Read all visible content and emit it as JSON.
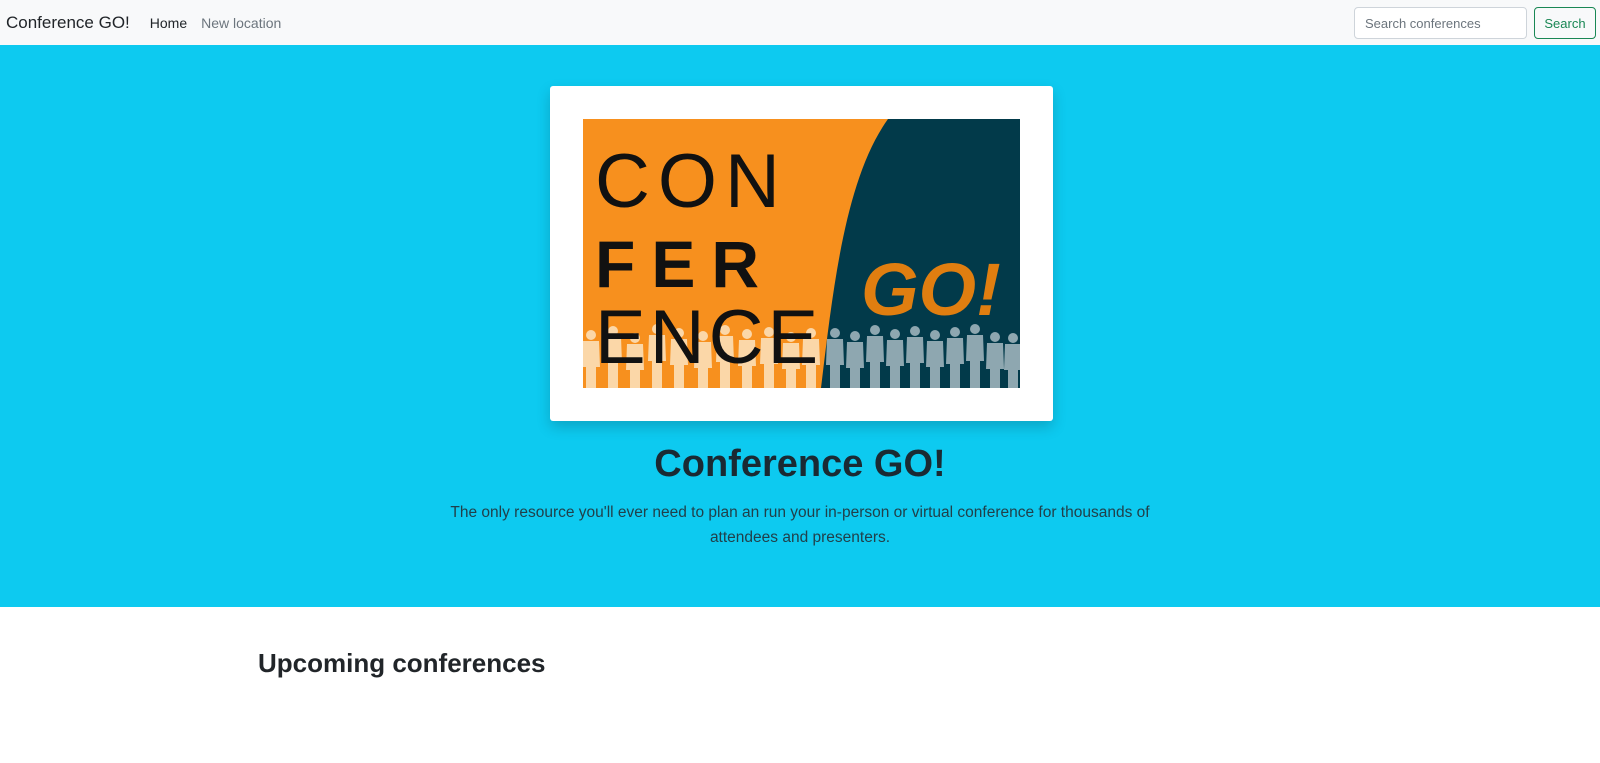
{
  "navbar": {
    "brand": "Conference GO!",
    "links": [
      {
        "label": "Home"
      },
      {
        "label": "New location"
      }
    ],
    "search": {
      "placeholder": "Search conferences",
      "value": "",
      "button_label": "Search"
    }
  },
  "hero": {
    "logo": {
      "text_lines": [
        "CON",
        "FER",
        "ENCE"
      ],
      "go_text": "GO!",
      "colors": {
        "orange": "#f7901e",
        "navy": "#023a4a",
        "go": "#e07e10",
        "silhouette_light": "#fbd7a8",
        "silhouette_dark": "#8ea7b0"
      }
    },
    "title": "Conference GO!",
    "lead": "The only resource you'll ever need to plan an run your in-person or virtual conference for thousands of attendees and presenters.",
    "background": "#0dcaf0"
  },
  "main": {
    "section_title": "Upcoming conferences"
  }
}
